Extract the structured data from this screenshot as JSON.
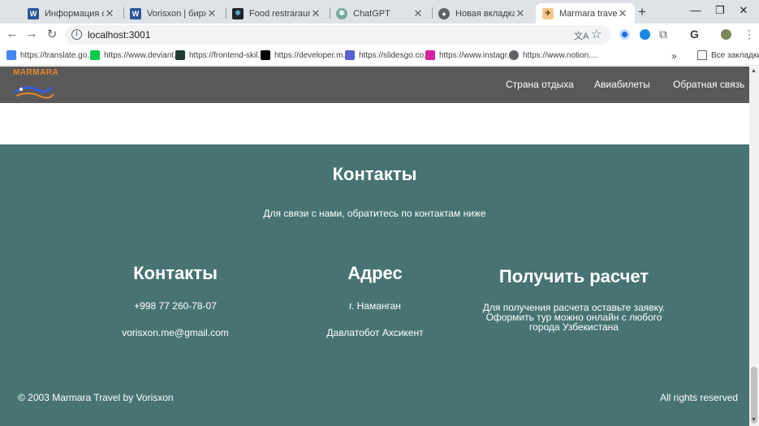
{
  "tabs": [
    {
      "title": "Информация о себе",
      "icon": "word-icon"
    },
    {
      "title": "Vorisxon | биржа фр",
      "icon": "word-icon"
    },
    {
      "title": "Food restraraunt",
      "icon": "react-icon"
    },
    {
      "title": "ChatGPT",
      "icon": "chatgpt-icon"
    },
    {
      "title": "Новая вкладка",
      "icon": "chrome-icon"
    },
    {
      "title": "Marmara travel",
      "icon": "marmara-icon"
    }
  ],
  "toolbar": {
    "url": "localhost:3001"
  },
  "bookmarks": [
    {
      "label": "https://translate.go..."
    },
    {
      "label": "https://www.deviant..."
    },
    {
      "label": "https://frontend-skil..."
    },
    {
      "label": "https://developer.m..."
    },
    {
      "label": "https://slidesgo.co..."
    },
    {
      "label": "https://www.instagr..."
    },
    {
      "label": "https://www.notion...."
    }
  ],
  "bookmarks_all": "Все закладки",
  "site": {
    "logo_text": "MARMARA",
    "nav": [
      "Страна отдыха",
      "Авиабилеты",
      "Обратная связь"
    ]
  },
  "contacts": {
    "title": "Контакты",
    "subtitle": "Для связи с нами, обратитесь по контактам ниже",
    "columns": [
      {
        "heading": "Контакты",
        "lines": [
          "+998 77 260-78-07",
          "vorisxon.me@gmail.com"
        ]
      },
      {
        "heading": "Адрес",
        "lines": [
          "г. Наманган",
          "Давлатобот Ахсикент"
        ]
      },
      {
        "heading": "Получить расчет",
        "lines": [
          "Для получения расчета оставьте заявку.",
          "Оформить тур можно онлайн с любого",
          "города Узбекистана"
        ]
      }
    ],
    "footer_left": "© 2003 Marmara Travel by Vorisxon",
    "footer_right": "All rights reserved"
  },
  "colors": {
    "section_bg": "#477473",
    "header_bg": "#595959",
    "logo_accent": "#e8892c"
  }
}
